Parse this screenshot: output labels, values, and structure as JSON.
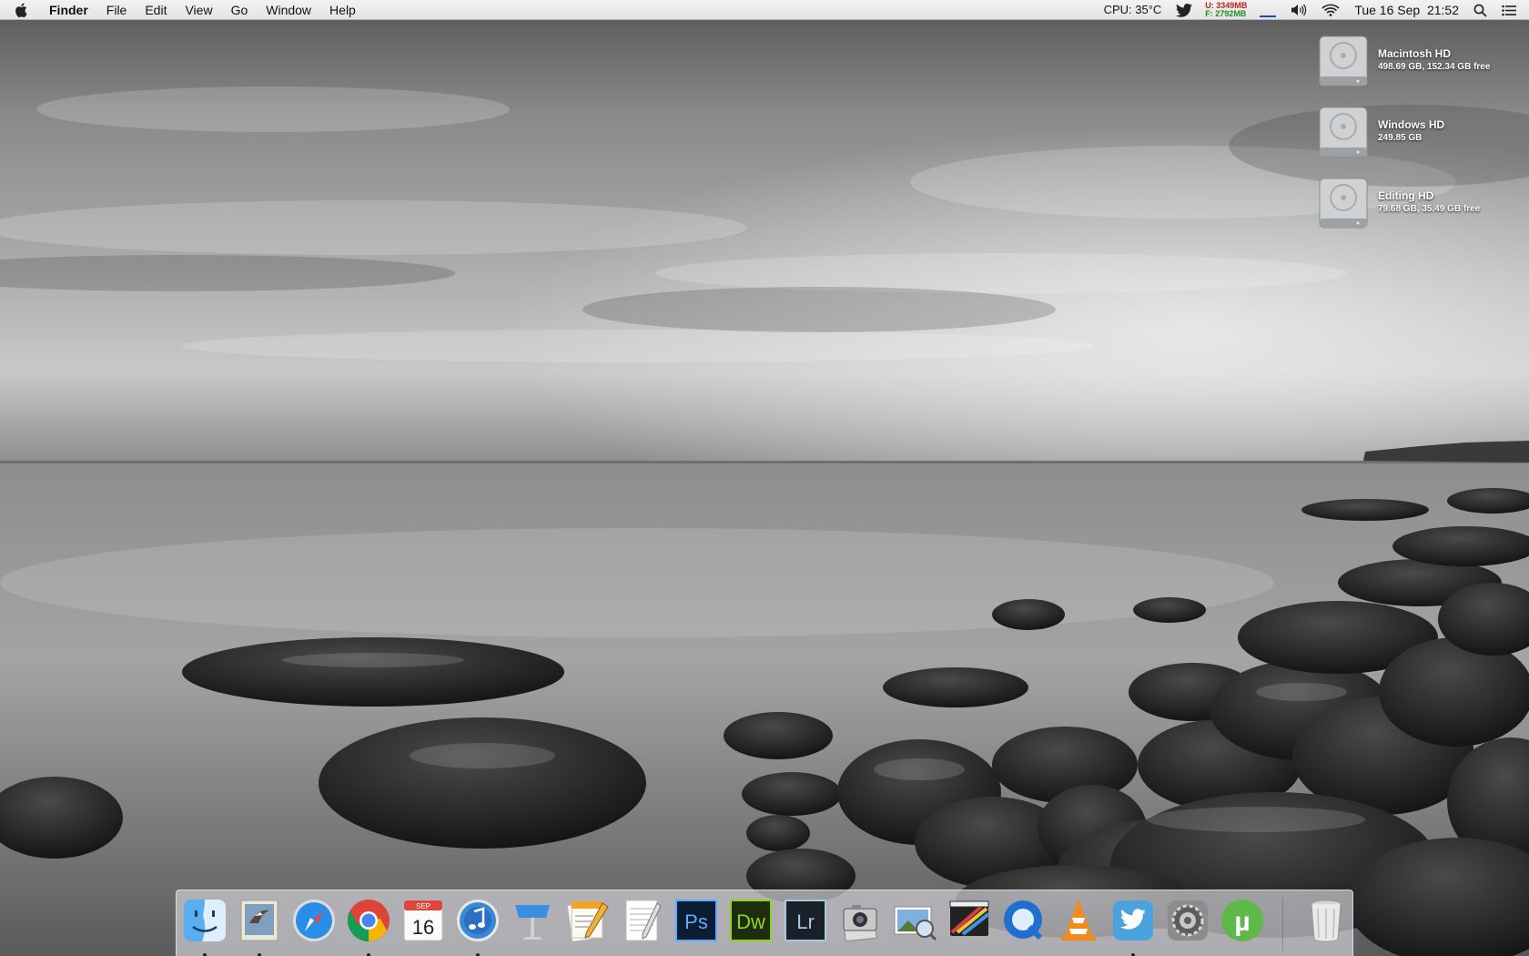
{
  "menubar": {
    "app_name": "Finder",
    "menus": [
      "File",
      "Edit",
      "View",
      "Go",
      "Window",
      "Help"
    ],
    "cpu": "CPU: 35°C",
    "mem_used": "U: 3349MB",
    "mem_free": "F: 2792MB",
    "datetime": "Tue 16 Sep  21:52",
    "icons": [
      "apple-icon",
      "twitter-icon",
      "network-graph-icon",
      "volume-icon",
      "wifi-icon",
      "spotlight-icon",
      "notification-center-icon"
    ]
  },
  "desktop": {
    "drives": [
      {
        "name": "Macintosh HD",
        "info": "498.69 GB, 152.34 GB free"
      },
      {
        "name": "Windows HD",
        "info": "249.85 GB"
      },
      {
        "name": "Editing HD",
        "info": "79.68 GB, 35.49 GB free"
      }
    ]
  },
  "dock": {
    "calendar_month": "SEP",
    "calendar_day": "16",
    "apps": [
      {
        "name": "Finder",
        "icon": "finder-icon",
        "running": true
      },
      {
        "name": "Mail",
        "icon": "mail-icon",
        "running": true
      },
      {
        "name": "Safari",
        "icon": "safari-icon",
        "running": false
      },
      {
        "name": "Chrome",
        "icon": "chrome-icon",
        "running": true
      },
      {
        "name": "Calendar",
        "icon": "calendar-icon",
        "running": false
      },
      {
        "name": "iTunes",
        "icon": "itunes-icon",
        "running": true
      },
      {
        "name": "Keynote",
        "icon": "keynote-icon",
        "running": false
      },
      {
        "name": "Pages",
        "icon": "pages-icon",
        "running": false
      },
      {
        "name": "TextEdit",
        "icon": "textedit-icon",
        "running": false
      },
      {
        "name": "Photoshop",
        "icon": "photoshop-icon",
        "label": "Ps",
        "running": false
      },
      {
        "name": "Dreamweaver",
        "icon": "dreamweaver-icon",
        "label": "Dw",
        "running": false
      },
      {
        "name": "Lightroom",
        "icon": "lightroom-icon",
        "label": "Lr",
        "running": false
      },
      {
        "name": "Image Capture",
        "icon": "image-capture-icon",
        "running": false
      },
      {
        "name": "Preview",
        "icon": "preview-icon",
        "running": false
      },
      {
        "name": "Final Cut Pro",
        "icon": "final-cut-icon",
        "running": false
      },
      {
        "name": "QuickTime",
        "icon": "quicktime-icon",
        "running": false
      },
      {
        "name": "VLC",
        "icon": "vlc-icon",
        "running": false
      },
      {
        "name": "Twitter",
        "icon": "twitter-app-icon",
        "running": true
      },
      {
        "name": "System Preferences",
        "icon": "system-preferences-icon",
        "running": false
      },
      {
        "name": "uTorrent",
        "icon": "utorrent-icon",
        "label": "µ",
        "running": false
      },
      {
        "name": "Trash",
        "icon": "trash-icon",
        "running": false
      }
    ]
  }
}
